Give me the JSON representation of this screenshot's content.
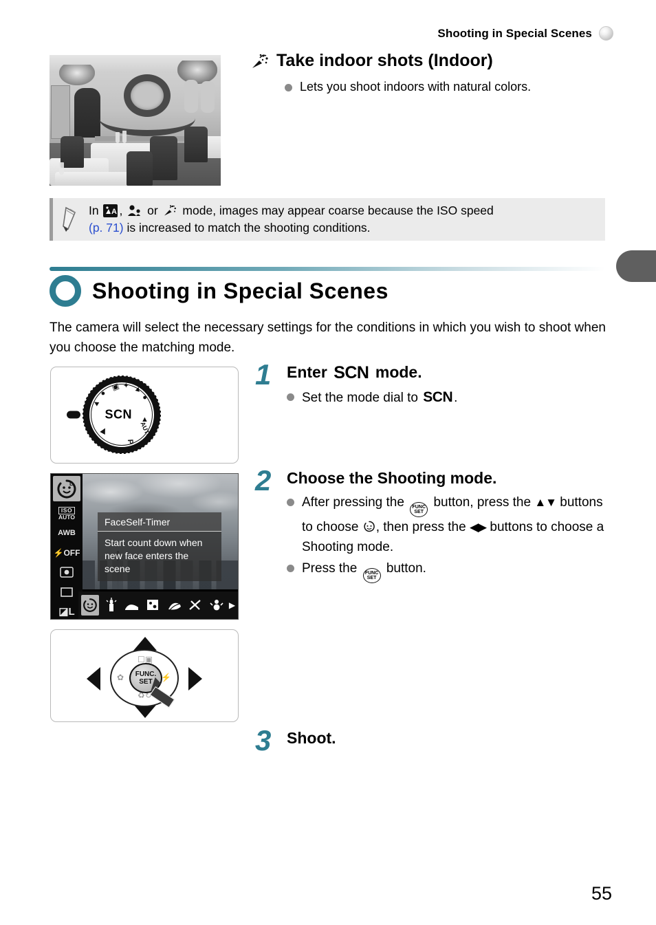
{
  "header": {
    "title": "Shooting in Special Scenes",
    "ball_icon": "sphere-icon"
  },
  "feature": {
    "icon": "party-popper-icon",
    "title": "Take indoor shots (Indoor)",
    "bullet": "Lets you shoot indoors with natural colors."
  },
  "photo": {
    "alt": "restaurant-interior-photo"
  },
  "note": {
    "pencil_icon": "pencil-icon",
    "prefix": "In",
    "icon1": "night-snapshot-icon",
    "sep1": ",",
    "icon2": "kids-and-pets-icon",
    "sep2": "or",
    "icon3": "indoor-icon",
    "text_after_icons": "mode, images may appear coarse because the ISO speed",
    "page_ref": "(p. 71)",
    "text_line2": "is increased to match the shooting conditions."
  },
  "section": {
    "ring_icon": "teal-ring-icon",
    "title": "Shooting in Special Scenes",
    "body": "The camera will select the necessary settings for the conditions in which you wish to shoot when you choose the matching mode."
  },
  "steps": [
    {
      "num": "1",
      "title_before": "Enter",
      "title_icon": "SCN",
      "title_after": "mode.",
      "bullets": [
        {
          "before": "Set the mode dial to",
          "icon": "SCN",
          "after": "."
        }
      ]
    },
    {
      "num": "2",
      "title": "Choose the Shooting mode.",
      "bullets": [
        {
          "p1": "After pressing the",
          "icon1": "func-set-button-icon",
          "p2": "button, press the",
          "icon2": "up-down-arrows-icon",
          "p3": "buttons to choose",
          "icon3": "face-self-timer-icon",
          "p4": ", then press the",
          "icon4": "left-right-arrows-icon",
          "p5": "buttons to choose a Shooting mode."
        },
        {
          "p1": "Press the",
          "icon1": "func-set-button-icon",
          "p2": "button."
        }
      ]
    },
    {
      "num": "3",
      "title": "Shoot."
    }
  ],
  "mode_dial": {
    "label": "SCN",
    "marker_icon": "dial-index-marker-icon",
    "surrounding_icons": [
      "portrait-icon",
      "landscape-icon",
      "night-icon",
      "movie-icon",
      "auto-icon",
      "program-icon",
      "scene-icon",
      "low-light-icon"
    ]
  },
  "lcd": {
    "sidebar_items": [
      {
        "name": "face-self-timer-icon",
        "label": "",
        "selected": true
      },
      {
        "name": "iso-icon",
        "label_top": "ISO",
        "label_bottom": "AUTO",
        "selected": false
      },
      {
        "name": "white-balance-icon",
        "label": "AWB",
        "selected": false
      },
      {
        "name": "flash-off-icon",
        "label": "OFF",
        "selected": false
      },
      {
        "name": "metering-icon",
        "label": "",
        "selected": false
      },
      {
        "name": "drive-mode-icon",
        "label": "",
        "selected": false
      },
      {
        "name": "image-quality-icon",
        "label": "L",
        "selected": false
      }
    ],
    "tooltip": {
      "title": "FaceSelf-Timer",
      "line1": "Start count down when",
      "line2": "new face enters the scene"
    },
    "strip_items": [
      {
        "name": "face-self-timer-icon",
        "selected": true
      },
      {
        "name": "low-light-candle-icon",
        "selected": false
      },
      {
        "name": "portrait-beach-icon",
        "selected": false
      },
      {
        "name": "kids-and-pets-icon",
        "selected": false
      },
      {
        "name": "foliage-icon",
        "selected": false
      },
      {
        "name": "fireworks-icon",
        "selected": false
      },
      {
        "name": "snow-icon",
        "selected": false
      }
    ],
    "scroll_arrow": "right-arrow-icon"
  },
  "controller": {
    "center_line1": "FUNC.",
    "center_line2": "SET",
    "quadrants": [
      "display-exposure-icon",
      "macro-icon",
      "flash-icon",
      "delete-timer-icon"
    ],
    "cursor_icon": "hand-cursor-icon"
  },
  "footer": {
    "page_number": "55"
  },
  "colors": {
    "accent_teal": "#2e7d91",
    "link_blue": "#2b4fcf",
    "note_bg": "#ebebeb",
    "tab_gray": "#5f5f5f"
  }
}
